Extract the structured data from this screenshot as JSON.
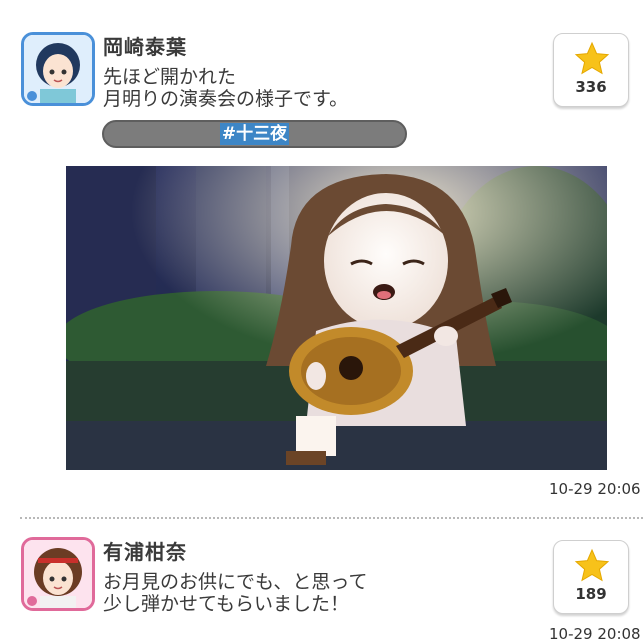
{
  "posts": [
    {
      "author": "岡崎泰葉",
      "lines": [
        "先ほど開かれた",
        "月明りの演奏会の様子です。"
      ],
      "hashtag": "#十三夜",
      "likes": "336",
      "timestamp": "10-29 20:06",
      "avatar_color": "#4a90d9"
    },
    {
      "author": "有浦柑奈",
      "lines": [
        "お月見のお供にでも、と思って",
        "少し弾かせてもらいました！"
      ],
      "likes": "189",
      "timestamp": "10-29 20:08",
      "avatar_color": "#e06a9a"
    }
  ],
  "colors": {
    "star": "#f7c21a",
    "hashtag_bg": "#7c7c7c",
    "hashtag_highlight": "#3d86c6"
  },
  "icons": {
    "like": "star-icon"
  }
}
